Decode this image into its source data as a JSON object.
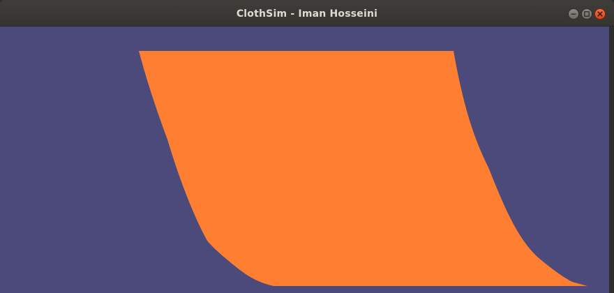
{
  "window": {
    "title": "ClothSim - Iman Hosseini",
    "controls": {
      "minimize": "minimize-icon",
      "maximize": "maximize-icon",
      "close": "close-icon"
    }
  },
  "scene": {
    "background_color": "#4b4a7a",
    "cloth_color": "#fe7f32"
  }
}
